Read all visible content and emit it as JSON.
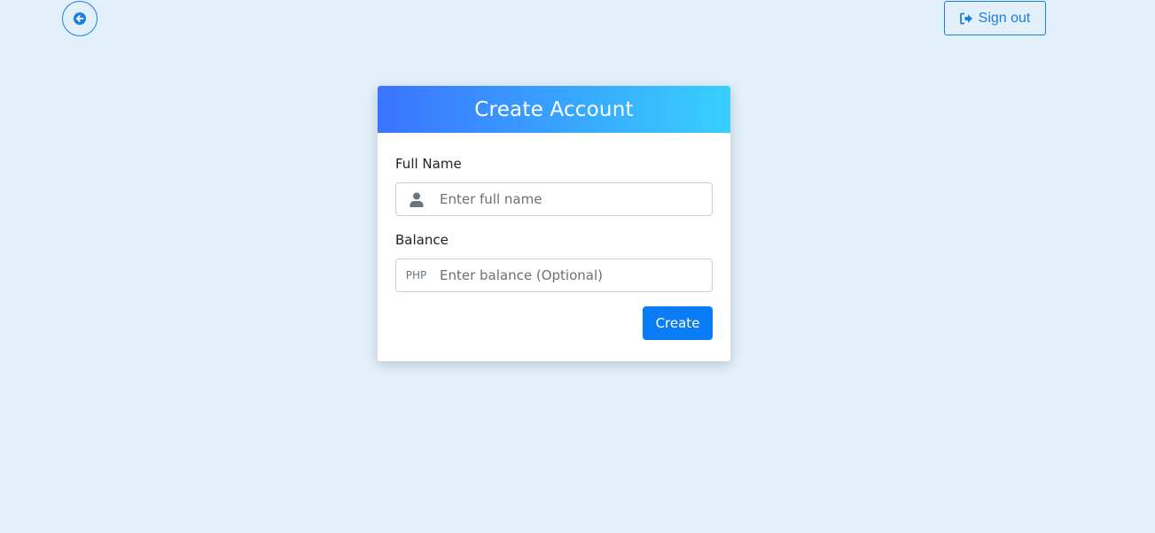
{
  "nav": {
    "back_icon": "arrow-left-icon",
    "signout_icon": "sign-out-icon",
    "signout_label": "Sign out"
  },
  "card": {
    "title": "Create Account",
    "full_name": {
      "label": "Full Name",
      "icon": "user-icon",
      "placeholder": "Enter full name",
      "value": ""
    },
    "balance": {
      "label": "Balance",
      "prefix": "PHP",
      "placeholder": "Enter balance (Optional)",
      "value": ""
    },
    "create_label": "Create"
  },
  "colors": {
    "background": "#e2f0fb",
    "accent": "#0a7cf5",
    "header_gradient_start": "#3a73ff",
    "header_gradient_end": "#37d0ff"
  }
}
